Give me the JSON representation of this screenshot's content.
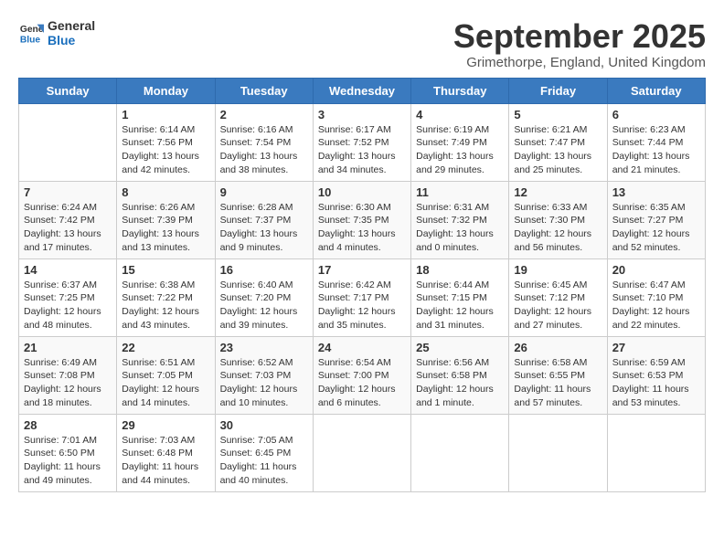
{
  "logo": {
    "line1": "General",
    "line2": "Blue"
  },
  "title": "September 2025",
  "subtitle": "Grimethorpe, England, United Kingdom",
  "headers": [
    "Sunday",
    "Monday",
    "Tuesday",
    "Wednesday",
    "Thursday",
    "Friday",
    "Saturday"
  ],
  "weeks": [
    [
      {
        "day": "",
        "info": ""
      },
      {
        "day": "1",
        "info": "Sunrise: 6:14 AM\nSunset: 7:56 PM\nDaylight: 13 hours\nand 42 minutes."
      },
      {
        "day": "2",
        "info": "Sunrise: 6:16 AM\nSunset: 7:54 PM\nDaylight: 13 hours\nand 38 minutes."
      },
      {
        "day": "3",
        "info": "Sunrise: 6:17 AM\nSunset: 7:52 PM\nDaylight: 13 hours\nand 34 minutes."
      },
      {
        "day": "4",
        "info": "Sunrise: 6:19 AM\nSunset: 7:49 PM\nDaylight: 13 hours\nand 29 minutes."
      },
      {
        "day": "5",
        "info": "Sunrise: 6:21 AM\nSunset: 7:47 PM\nDaylight: 13 hours\nand 25 minutes."
      },
      {
        "day": "6",
        "info": "Sunrise: 6:23 AM\nSunset: 7:44 PM\nDaylight: 13 hours\nand 21 minutes."
      }
    ],
    [
      {
        "day": "7",
        "info": "Sunrise: 6:24 AM\nSunset: 7:42 PM\nDaylight: 13 hours\nand 17 minutes."
      },
      {
        "day": "8",
        "info": "Sunrise: 6:26 AM\nSunset: 7:39 PM\nDaylight: 13 hours\nand 13 minutes."
      },
      {
        "day": "9",
        "info": "Sunrise: 6:28 AM\nSunset: 7:37 PM\nDaylight: 13 hours\nand 9 minutes."
      },
      {
        "day": "10",
        "info": "Sunrise: 6:30 AM\nSunset: 7:35 PM\nDaylight: 13 hours\nand 4 minutes."
      },
      {
        "day": "11",
        "info": "Sunrise: 6:31 AM\nSunset: 7:32 PM\nDaylight: 13 hours\nand 0 minutes."
      },
      {
        "day": "12",
        "info": "Sunrise: 6:33 AM\nSunset: 7:30 PM\nDaylight: 12 hours\nand 56 minutes."
      },
      {
        "day": "13",
        "info": "Sunrise: 6:35 AM\nSunset: 7:27 PM\nDaylight: 12 hours\nand 52 minutes."
      }
    ],
    [
      {
        "day": "14",
        "info": "Sunrise: 6:37 AM\nSunset: 7:25 PM\nDaylight: 12 hours\nand 48 minutes."
      },
      {
        "day": "15",
        "info": "Sunrise: 6:38 AM\nSunset: 7:22 PM\nDaylight: 12 hours\nand 43 minutes."
      },
      {
        "day": "16",
        "info": "Sunrise: 6:40 AM\nSunset: 7:20 PM\nDaylight: 12 hours\nand 39 minutes."
      },
      {
        "day": "17",
        "info": "Sunrise: 6:42 AM\nSunset: 7:17 PM\nDaylight: 12 hours\nand 35 minutes."
      },
      {
        "day": "18",
        "info": "Sunrise: 6:44 AM\nSunset: 7:15 PM\nDaylight: 12 hours\nand 31 minutes."
      },
      {
        "day": "19",
        "info": "Sunrise: 6:45 AM\nSunset: 7:12 PM\nDaylight: 12 hours\nand 27 minutes."
      },
      {
        "day": "20",
        "info": "Sunrise: 6:47 AM\nSunset: 7:10 PM\nDaylight: 12 hours\nand 22 minutes."
      }
    ],
    [
      {
        "day": "21",
        "info": "Sunrise: 6:49 AM\nSunset: 7:08 PM\nDaylight: 12 hours\nand 18 minutes."
      },
      {
        "day": "22",
        "info": "Sunrise: 6:51 AM\nSunset: 7:05 PM\nDaylight: 12 hours\nand 14 minutes."
      },
      {
        "day": "23",
        "info": "Sunrise: 6:52 AM\nSunset: 7:03 PM\nDaylight: 12 hours\nand 10 minutes."
      },
      {
        "day": "24",
        "info": "Sunrise: 6:54 AM\nSunset: 7:00 PM\nDaylight: 12 hours\nand 6 minutes."
      },
      {
        "day": "25",
        "info": "Sunrise: 6:56 AM\nSunset: 6:58 PM\nDaylight: 12 hours\nand 1 minute."
      },
      {
        "day": "26",
        "info": "Sunrise: 6:58 AM\nSunset: 6:55 PM\nDaylight: 11 hours\nand 57 minutes."
      },
      {
        "day": "27",
        "info": "Sunrise: 6:59 AM\nSunset: 6:53 PM\nDaylight: 11 hours\nand 53 minutes."
      }
    ],
    [
      {
        "day": "28",
        "info": "Sunrise: 7:01 AM\nSunset: 6:50 PM\nDaylight: 11 hours\nand 49 minutes."
      },
      {
        "day": "29",
        "info": "Sunrise: 7:03 AM\nSunset: 6:48 PM\nDaylight: 11 hours\nand 44 minutes."
      },
      {
        "day": "30",
        "info": "Sunrise: 7:05 AM\nSunset: 6:45 PM\nDaylight: 11 hours\nand 40 minutes."
      },
      {
        "day": "",
        "info": ""
      },
      {
        "day": "",
        "info": ""
      },
      {
        "day": "",
        "info": ""
      },
      {
        "day": "",
        "info": ""
      }
    ]
  ]
}
